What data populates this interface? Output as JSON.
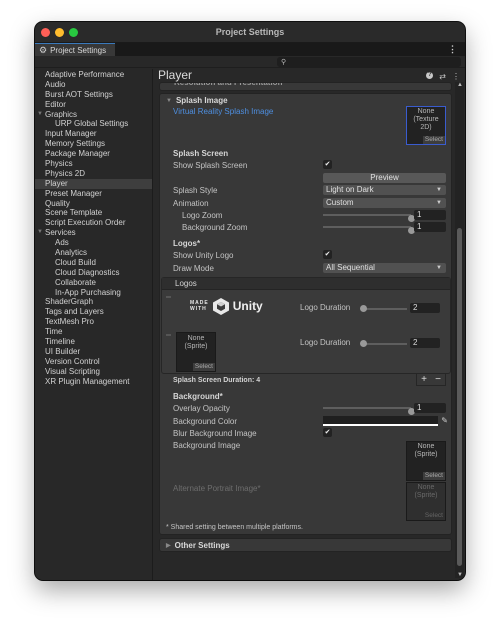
{
  "window": {
    "title": "Project Settings",
    "tab_label": "Project Settings",
    "search_placeholder": ""
  },
  "sidebar": {
    "items": [
      {
        "label": "Adaptive Performance",
        "level": 0
      },
      {
        "label": "Audio",
        "level": 0
      },
      {
        "label": "Burst AOT Settings",
        "level": 0
      },
      {
        "label": "Editor",
        "level": 0
      },
      {
        "label": "Graphics",
        "level": 0,
        "expanded": true
      },
      {
        "label": "URP Global Settings",
        "level": 1
      },
      {
        "label": "Input Manager",
        "level": 0
      },
      {
        "label": "Memory Settings",
        "level": 0
      },
      {
        "label": "Package Manager",
        "level": 0
      },
      {
        "label": "Physics",
        "level": 0
      },
      {
        "label": "Physics 2D",
        "level": 0
      },
      {
        "label": "Player",
        "level": 0,
        "selected": true
      },
      {
        "label": "Preset Manager",
        "level": 0
      },
      {
        "label": "Quality",
        "level": 0
      },
      {
        "label": "Scene Template",
        "level": 0
      },
      {
        "label": "Script Execution Order",
        "level": 0
      },
      {
        "label": "Services",
        "level": 0,
        "expanded": true
      },
      {
        "label": "Ads",
        "level": 1
      },
      {
        "label": "Analytics",
        "level": 1
      },
      {
        "label": "Cloud Build",
        "level": 1
      },
      {
        "label": "Cloud Diagnostics",
        "level": 1
      },
      {
        "label": "Collaborate",
        "level": 1
      },
      {
        "label": "In-App Purchasing",
        "level": 1
      },
      {
        "label": "ShaderGraph",
        "level": 0
      },
      {
        "label": "Tags and Layers",
        "level": 0
      },
      {
        "label": "TextMesh Pro",
        "level": 0
      },
      {
        "label": "Time",
        "level": 0
      },
      {
        "label": "Timeline",
        "level": 0
      },
      {
        "label": "UI Builder",
        "level": 0
      },
      {
        "label": "Version Control",
        "level": 0
      },
      {
        "label": "Visual Scripting",
        "level": 0
      },
      {
        "label": "XR Plugin Management",
        "level": 0
      }
    ]
  },
  "main": {
    "title": "Player",
    "collapsed_above": "Resolution and Presentation",
    "splash_image": {
      "title": "Splash Image",
      "vr_splash_label": "Virtual Reality Splash Image",
      "vr_splash_value_line1": "None",
      "vr_splash_value_line2": "(Texture 2D)",
      "select_label": "Select",
      "splash_screen_title": "Splash Screen",
      "show_splash_label": "Show Splash Screen",
      "show_splash_checked": true,
      "preview_button": "Preview",
      "splash_style_label": "Splash Style",
      "splash_style_value": "Light on Dark",
      "animation_label": "Animation",
      "animation_value": "Custom",
      "logo_zoom_label": "Logo Zoom",
      "logo_zoom_value": "1",
      "logo_zoom_fraction": 1.0,
      "background_zoom_label": "Background Zoom",
      "background_zoom_value": "1",
      "background_zoom_fraction": 1.0,
      "logos_title": "Logos*",
      "show_unity_logo_label": "Show Unity Logo",
      "show_unity_logo_checked": true,
      "draw_mode_label": "Draw Mode",
      "draw_mode_value": "All Sequential",
      "logos_list_header": "Logos",
      "logo_entries": [
        {
          "type": "made-with-unity",
          "made": "MADE",
          "with": "WITH",
          "brand": "Unity",
          "duration_label": "Logo Duration",
          "duration": "2",
          "duration_fraction": 0.0
        },
        {
          "type": "sprite",
          "value_line1": "None",
          "value_line2": "(Sprite)",
          "select": "Select",
          "duration_label": "Logo Duration",
          "duration": "2",
          "duration_fraction": 0.0
        }
      ],
      "splash_duration": "Splash Screen Duration: 4",
      "add_symbol": "+",
      "remove_symbol": "−",
      "background_title": "Background*",
      "overlay_opacity_label": "Overlay Opacity",
      "overlay_opacity_value": "1",
      "overlay_opacity_fraction": 1.0,
      "background_color_label": "Background Color",
      "background_color": "#1f1f1f",
      "blur_bg_label": "Blur Background Image",
      "blur_bg_checked": true,
      "background_image_label": "Background Image",
      "background_image_line1": "None",
      "background_image_line2": "(Sprite)",
      "alt_portrait_label": "Alternate Portrait Image*",
      "alt_portrait_line1": "None",
      "alt_portrait_line2": "(Sprite)",
      "footnote": "* Shared setting between multiple platforms."
    },
    "other_settings": "Other Settings"
  },
  "icons": {
    "gear": "⚙",
    "menu": "⋮",
    "search": "🔍",
    "help": "?",
    "presets": "⇄",
    "check": "✔",
    "dropdown": "▼",
    "fold_open": "▼",
    "fold_closed": "▶",
    "eyedropper": "✎",
    "scroll_up": "▲",
    "scroll_down": "▼"
  },
  "colors": {
    "link": "#4e8fe0",
    "selection_outline": "#3a5ccf",
    "tab_accent": "#3a79bb"
  }
}
